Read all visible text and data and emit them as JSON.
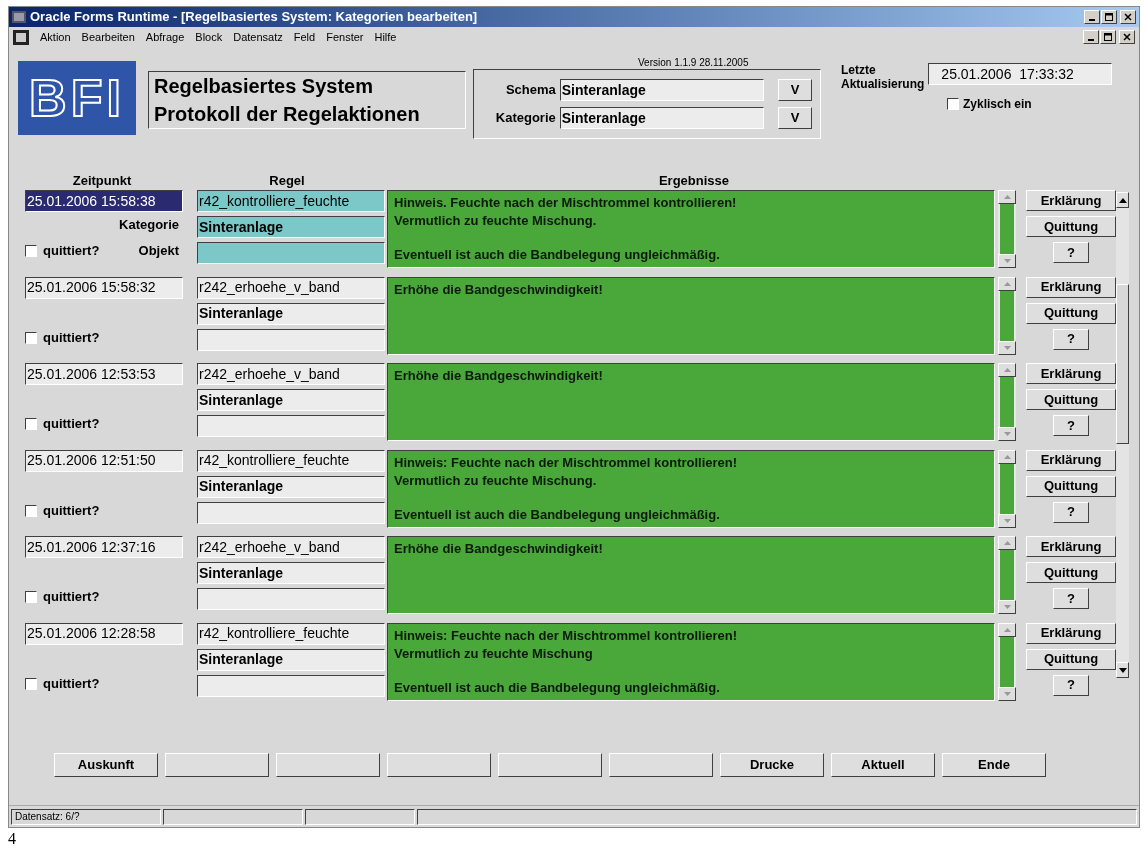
{
  "window": {
    "title": "Oracle Forms Runtime - [Regelbasiertes System: Kategorien bearbeiten]"
  },
  "menu": [
    "Aktion",
    "Bearbeiten",
    "Abfrage",
    "Block",
    "Datensatz",
    "Feld",
    "Fenster",
    "Hilfe"
  ],
  "header": {
    "title_lines": [
      "Regelbasiertes System",
      "Protokoll der Regelaktionen"
    ],
    "logo": "BFI",
    "version": "Version 1.1.9  28.11.2005",
    "filters": [
      {
        "label": "Schema",
        "value": "Sinteranlage",
        "button": "V"
      },
      {
        "label": "Kategorie",
        "value": "Sinteranlage",
        "button": "V"
      }
    ],
    "last_update": {
      "label_lines": [
        "Letzte",
        "Aktualisierung"
      ],
      "value": "25.01.2006  17:33:32"
    },
    "cyclic": {
      "label": "Zyklisch ein",
      "checked": false
    }
  },
  "columns": [
    "Zeitpunkt",
    "Regel",
    "Ergebnisse"
  ],
  "labels": {
    "category": "Kategorie",
    "object": "Objekt"
  },
  "records": [
    {
      "selected": true,
      "time": "25.01.2006 15:58:38",
      "rule": "r42_kontrolliere_feuchte",
      "category": "Sinteranlage",
      "acknowledged": false,
      "ack_label": "quittiert?",
      "lines": [
        "Hinweis. Feuchte nach der Mischtrommel kontrollieren!",
        "Vermutlich zu feuchte Mischung."
      ],
      "note": "Eventuell ist auch die Bandbelegung ungleichmäßig.",
      "buttons": [
        "Erklärung",
        "Quittung",
        "?"
      ]
    },
    {
      "selected": false,
      "time": "25.01.2006 15:58:32",
      "rule": "r242_erhoehe_v_band",
      "category": "Sinteranlage",
      "acknowledged": false,
      "ack_label": "quittiert?",
      "lines": [
        "Erhöhe die Bandgeschwindigkeit!"
      ],
      "buttons": [
        "Erklärung",
        "Quittung",
        "?"
      ]
    },
    {
      "selected": false,
      "time": "25.01.2006 12:53:53",
      "rule": "r242_erhoehe_v_band",
      "category": "Sinteranlage",
      "acknowledged": false,
      "ack_label": "quittiert?",
      "lines": [
        "Erhöhe die Bandgeschwindigkeit!"
      ],
      "buttons": [
        "Erklärung",
        "Quittung",
        "?"
      ]
    },
    {
      "selected": false,
      "time": "25.01.2006 12:51:50",
      "rule": "r42_kontrolliere_feuchte",
      "category": "Sinteranlage",
      "acknowledged": false,
      "ack_label": "quittiert?",
      "lines": [
        "Hinweis: Feuchte nach der Mischtrommel kontrollieren!",
        "Vermutlich zu feuchte Mischung."
      ],
      "note": "Eventuell ist auch die Bandbelegung ungleichmäßig.",
      "buttons": [
        "Erklärung",
        "Quittung",
        "?"
      ]
    },
    {
      "selected": false,
      "time": "25.01.2006 12:37:16",
      "rule": "r242_erhoehe_v_band",
      "category": "Sinteranlage",
      "acknowledged": false,
      "ack_label": "quittiert?",
      "lines": [
        "Erhöhe die Bandgeschwindigkeit!"
      ],
      "buttons": [
        "Erklärung",
        "Quittung",
        "?"
      ]
    },
    {
      "selected": false,
      "time": "25.01.2006 12:28:58",
      "rule": "r42_kontrolliere_feuchte",
      "category": "Sinteranlage",
      "acknowledged": false,
      "ack_label": "quittiert?",
      "lines": [
        "Hinweis: Feuchte nach der Mischtrommel kontrollieren!",
        "Vermutlich zu feuchte Mischung"
      ],
      "note": "Eventuell ist auch die Bandbelegung ungleichmäßig.",
      "buttons": [
        "Erklärung",
        "Quittung",
        "?"
      ]
    }
  ],
  "buttons": [
    {
      "kind": "text",
      "label": "Auskunft"
    },
    {
      "kind": "blank"
    },
    {
      "kind": "blank"
    },
    {
      "kind": "blank"
    },
    {
      "kind": "blank"
    },
    {
      "kind": "blank"
    },
    {
      "kind": "text",
      "label": "Drucke"
    },
    {
      "kind": "text",
      "label": "Aktuell"
    },
    {
      "kind": "text",
      "label": "Ende"
    }
  ],
  "status_bar": [
    "Datensatz: 6/?"
  ],
  "page_number": "4"
}
